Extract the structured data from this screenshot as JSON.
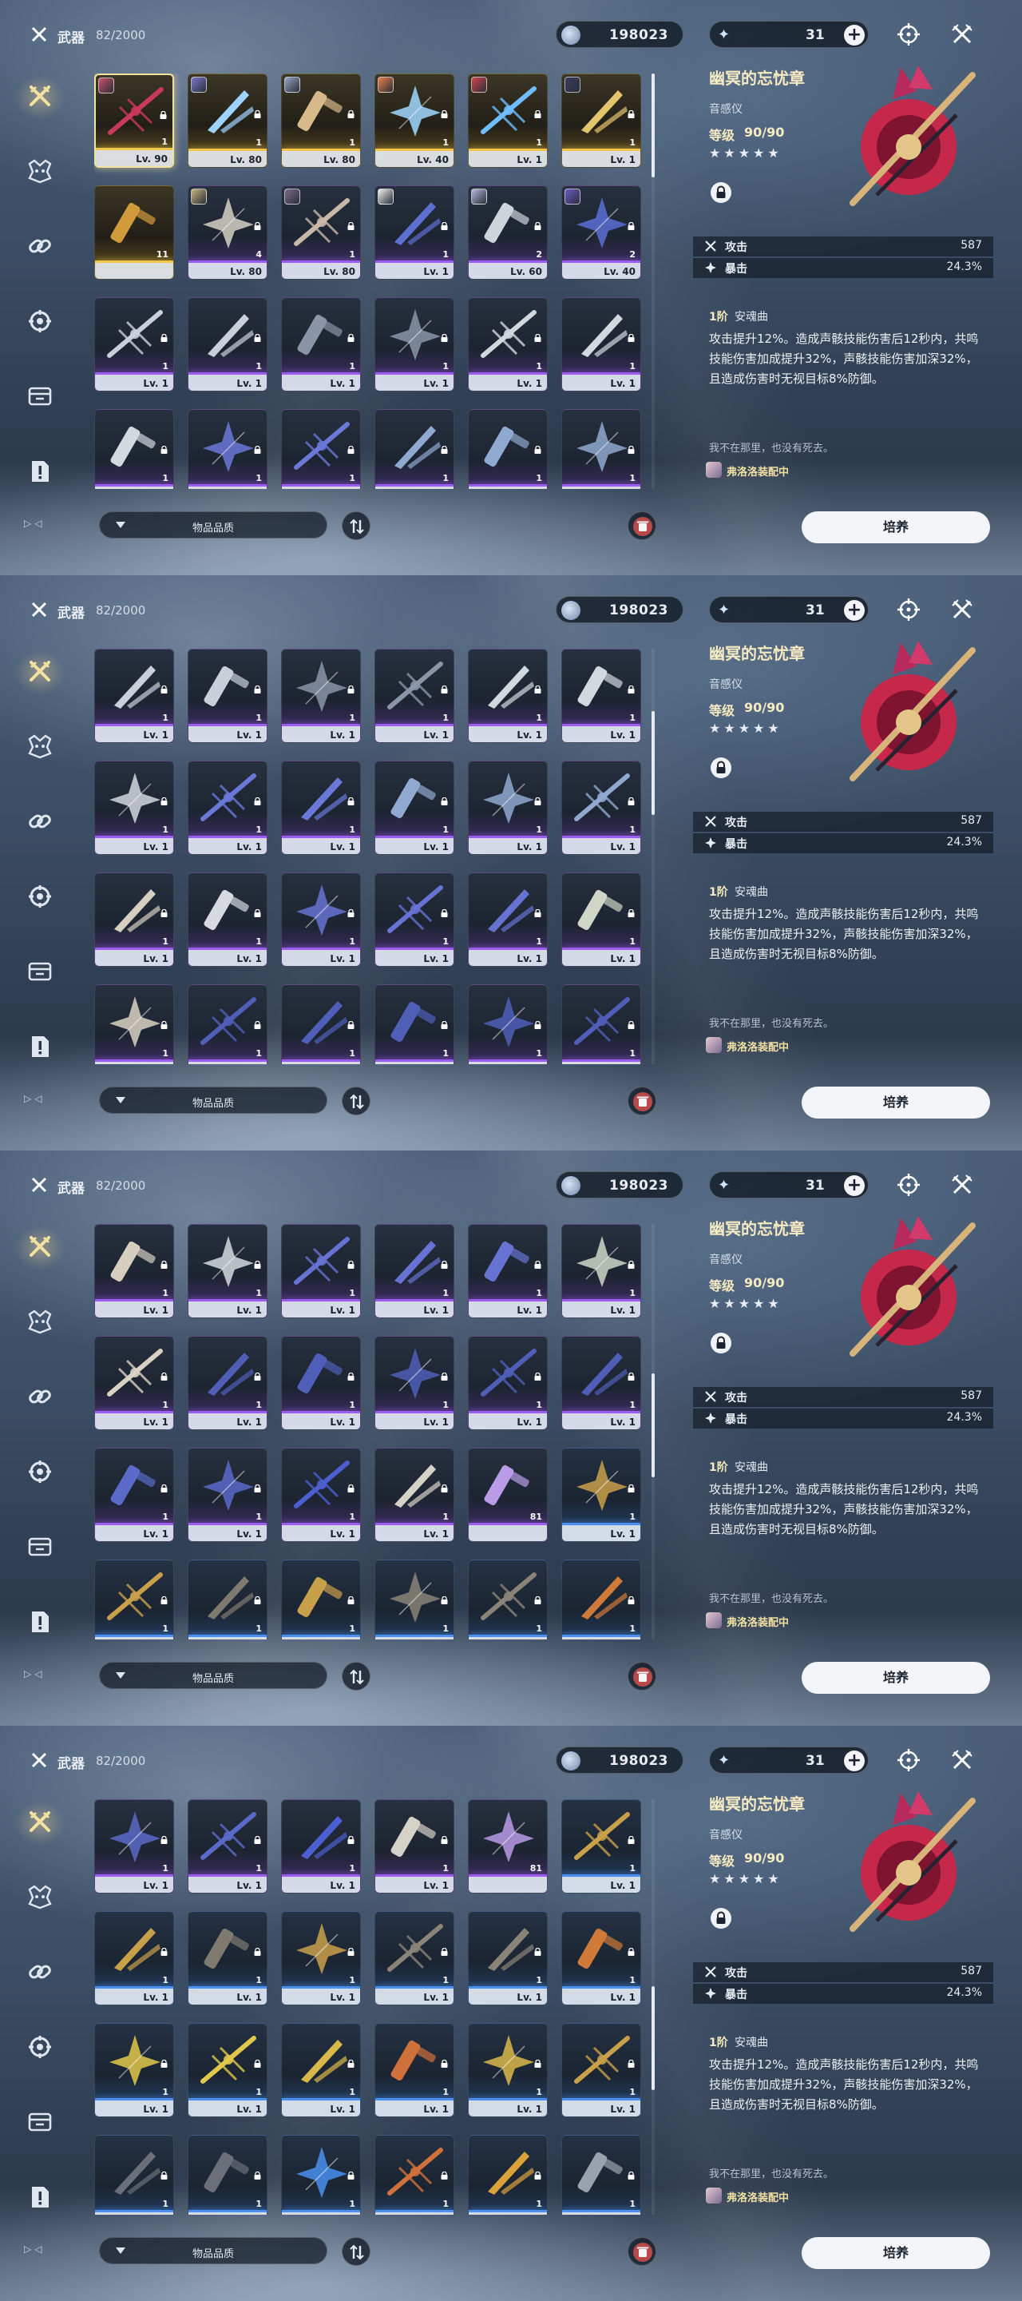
{
  "header": {
    "title": "武器",
    "count": "82/2000",
    "coins": "198023",
    "energy": "31",
    "plus": "+"
  },
  "sidebar": {
    "items": [
      {
        "name": "weapon-icon",
        "active": true
      },
      {
        "name": "echo-icon"
      },
      {
        "name": "link-icon"
      },
      {
        "name": "gear-item-icon"
      },
      {
        "name": "supply-icon"
      },
      {
        "name": "quest-item-icon"
      }
    ],
    "nav": "▷◁"
  },
  "filter": {
    "label": "物品品质"
  },
  "detail": {
    "name": "幽冥的忘忧章",
    "type": "音感仪",
    "level_label": "等级",
    "level_value": "90/90",
    "stars": "★★★★★",
    "stats": [
      {
        "name": "攻击",
        "value": "587",
        "icon": "attack-icon"
      },
      {
        "name": "暴击",
        "value": "24.3%",
        "icon": "crit-icon"
      }
    ],
    "rank": "1阶",
    "rank_name": "安魂曲",
    "description": "攻击提升12%。造成声骸技能伤害后12秒内，共鸣技能伤害加成提升32%，声骸技能伤害加深32%，且造成伤害时无视目标8%防御。",
    "quote": "我不在那里，也没有死去。",
    "equipped_by": "弗洛洛装配中",
    "button": "培养"
  },
  "colors": {
    "accent_gold": "#f3e1a1",
    "rarity_purple": "#9b5cf0",
    "rarity_gold": "#f2c64a",
    "rarity_blue": "#4a90f0"
  },
  "panels": [
    {
      "scroll_pos": 0.0,
      "rows": [
        [
          {
            "lv": "Lv. 90",
            "qty": "1",
            "rarity": "gold",
            "avatar": "#c9506a",
            "locked": true,
            "selected": true,
            "tint": "#c9395a"
          },
          {
            "lv": "Lv. 80",
            "qty": "1",
            "rarity": "gold",
            "avatar": "#7a79c9",
            "locked": true,
            "tint": "#9fd3ff"
          },
          {
            "lv": "Lv. 80",
            "qty": "1",
            "rarity": "gold",
            "avatar": "#9aa4c2",
            "locked": true,
            "tint": "#d7b98a"
          },
          {
            "lv": "Lv. 40",
            "qty": "1",
            "rarity": "gold",
            "avatar": "#e8804a",
            "locked": true,
            "tint": "#9fd9ff"
          },
          {
            "lv": "Lv. 1",
            "qty": "1",
            "rarity": "gold",
            "avatar": "#d4424a",
            "locked": true,
            "tint": "#6fbcff"
          },
          {
            "lv": "Lv. 1",
            "qty": "1",
            "rarity": "gold",
            "avatar": "#3b3b5c",
            "locked": true,
            "tint": "#e3c36b"
          }
        ],
        [
          {
            "lv": "",
            "qty": "11",
            "rarity": "gold",
            "tint": "#d19a3a"
          },
          {
            "lv": "Lv. 80",
            "qty": "4",
            "rarity": "purple",
            "avatar": "#c9b27e",
            "locked": true,
            "tint": "#d6d1c4"
          },
          {
            "lv": "Lv. 80",
            "qty": "1",
            "rarity": "purple",
            "avatar": "#7a6b8c",
            "locked": true,
            "tint": "#c9b8a8"
          },
          {
            "lv": "Lv. 1",
            "qty": "1",
            "rarity": "purple",
            "avatar": "#f0f0f0",
            "locked": true,
            "tint": "#5d6fd0"
          },
          {
            "lv": "Lv. 60",
            "qty": "2",
            "rarity": "purple",
            "avatar": "#b6b8d9",
            "locked": true,
            "tint": "#cfd3da"
          },
          {
            "lv": "Lv. 40",
            "qty": "2",
            "rarity": "purple",
            "avatar": "#6d5ac7",
            "locked": true,
            "tint": "#5b6fd3"
          }
        ],
        [
          {
            "lv": "Lv. 1",
            "qty": "1",
            "rarity": "purple",
            "locked": true,
            "tint": "#c9d0da"
          },
          {
            "lv": "Lv. 1",
            "qty": "1",
            "rarity": "purple",
            "locked": true,
            "tint": "#c9d0da"
          },
          {
            "lv": "Lv. 1",
            "qty": "1",
            "rarity": "purple",
            "locked": true,
            "tint": "#8a96a8"
          },
          {
            "lv": "Lv. 1",
            "qty": "1",
            "rarity": "purple",
            "locked": true,
            "tint": "#8a96a8"
          },
          {
            "lv": "Lv. 1",
            "qty": "1",
            "rarity": "purple",
            "locked": true,
            "tint": "#d3d7de"
          },
          {
            "lv": "Lv. 1",
            "qty": "1",
            "rarity": "purple",
            "locked": true,
            "tint": "#d3d7de"
          }
        ],
        [
          {
            "lv": "",
            "qty": "1",
            "rarity": "purple",
            "locked": true,
            "tint": "#d3d7de"
          },
          {
            "lv": "",
            "qty": "1",
            "rarity": "purple",
            "locked": true,
            "tint": "#6a78d8"
          },
          {
            "lv": "",
            "qty": "1",
            "rarity": "purple",
            "locked": true,
            "tint": "#6a78d8"
          },
          {
            "lv": "",
            "qty": "1",
            "rarity": "purple",
            "locked": true,
            "tint": "#8fa9d0"
          },
          {
            "lv": "",
            "qty": "1",
            "rarity": "purple",
            "locked": true,
            "tint": "#8fa9d0"
          },
          {
            "lv": "",
            "qty": "1",
            "rarity": "purple",
            "locked": true,
            "tint": "#8fa9d0"
          }
        ]
      ]
    },
    {
      "scroll_pos": 0.2,
      "rows": [
        [
          {
            "lv": "Lv. 1",
            "qty": "1",
            "rarity": "purple",
            "locked": true,
            "tint": "#c9d0da"
          },
          {
            "lv": "Lv. 1",
            "qty": "1",
            "rarity": "purple",
            "locked": true,
            "tint": "#c9d0da"
          },
          {
            "lv": "Lv. 1",
            "qty": "1",
            "rarity": "purple",
            "locked": true,
            "tint": "#8a96a8"
          },
          {
            "lv": "Lv. 1",
            "qty": "1",
            "rarity": "purple",
            "locked": true,
            "tint": "#8a96a8"
          },
          {
            "lv": "Lv. 1",
            "qty": "1",
            "rarity": "purple",
            "locked": true,
            "tint": "#d3d7de"
          },
          {
            "lv": "Lv. 1",
            "qty": "1",
            "rarity": "purple",
            "locked": true,
            "tint": "#d3d7de"
          }
        ],
        [
          {
            "lv": "Lv. 1",
            "qty": "1",
            "rarity": "purple",
            "locked": true,
            "tint": "#d3d7de"
          },
          {
            "lv": "Lv. 1",
            "qty": "1",
            "rarity": "purple",
            "locked": true,
            "tint": "#6a78d8"
          },
          {
            "lv": "Lv. 1",
            "qty": "1",
            "rarity": "purple",
            "locked": true,
            "tint": "#6a78d8"
          },
          {
            "lv": "Lv. 1",
            "qty": "1",
            "rarity": "purple",
            "locked": true,
            "tint": "#8fa9d0"
          },
          {
            "lv": "Lv. 1",
            "qty": "1",
            "rarity": "purple",
            "locked": true,
            "tint": "#8fa9d0"
          },
          {
            "lv": "Lv. 1",
            "qty": "1",
            "rarity": "purple",
            "locked": true,
            "tint": "#8fa9d0"
          }
        ],
        [
          {
            "lv": "Lv. 1",
            "qty": "1",
            "rarity": "purple",
            "locked": true,
            "tint": "#d6cfc0"
          },
          {
            "lv": "Lv. 1",
            "qty": "1",
            "rarity": "purple",
            "locked": true,
            "tint": "#d6d9df"
          },
          {
            "lv": "Lv. 1",
            "qty": "1",
            "rarity": "purple",
            "locked": true,
            "tint": "#6673d2"
          },
          {
            "lv": "Lv. 1",
            "qty": "1",
            "rarity": "purple",
            "locked": true,
            "tint": "#6673d2"
          },
          {
            "lv": "Lv. 1",
            "qty": "1",
            "rarity": "purple",
            "locked": true,
            "tint": "#6673d2"
          },
          {
            "lv": "Lv. 1",
            "qty": "1",
            "rarity": "purple",
            "locked": true,
            "tint": "#cfd6c8"
          }
        ],
        [
          {
            "lv": "",
            "qty": "1",
            "rarity": "purple",
            "locked": true,
            "tint": "#d9d2c2"
          },
          {
            "lv": "",
            "qty": "1",
            "rarity": "purple",
            "locked": true,
            "tint": "#4f5fb8"
          },
          {
            "lv": "",
            "qty": "1",
            "rarity": "purple",
            "locked": true,
            "tint": "#4f5fb8"
          },
          {
            "lv": "",
            "qty": "1",
            "rarity": "purple",
            "locked": true,
            "tint": "#4f5fb8"
          },
          {
            "lv": "",
            "qty": "1",
            "rarity": "purple",
            "locked": true,
            "tint": "#4f5fb8"
          },
          {
            "lv": "",
            "qty": "1",
            "rarity": "purple",
            "locked": true,
            "tint": "#4f5fb8"
          }
        ]
      ]
    },
    {
      "scroll_pos": 0.48,
      "rows": [
        [
          {
            "lv": "Lv. 1",
            "qty": "1",
            "rarity": "purple",
            "locked": true,
            "tint": "#d6cfc0"
          },
          {
            "lv": "Lv. 1",
            "qty": "1",
            "rarity": "purple",
            "locked": true,
            "tint": "#d6d9df"
          },
          {
            "lv": "Lv. 1",
            "qty": "1",
            "rarity": "purple",
            "locked": true,
            "tint": "#6673d2"
          },
          {
            "lv": "Lv. 1",
            "qty": "1",
            "rarity": "purple",
            "locked": true,
            "tint": "#6673d2"
          },
          {
            "lv": "Lv. 1",
            "qty": "1",
            "rarity": "purple",
            "locked": true,
            "tint": "#6673d2"
          },
          {
            "lv": "Lv. 1",
            "qty": "1",
            "rarity": "purple",
            "locked": true,
            "tint": "#cfd6c8"
          }
        ],
        [
          {
            "lv": "Lv. 1",
            "qty": "1",
            "rarity": "purple",
            "locked": true,
            "tint": "#d9d2c2"
          },
          {
            "lv": "Lv. 1",
            "qty": "1",
            "rarity": "purple",
            "locked": true,
            "tint": "#4f5fb8"
          },
          {
            "lv": "Lv. 1",
            "qty": "1",
            "rarity": "purple",
            "locked": true,
            "tint": "#4f5fb8"
          },
          {
            "lv": "Lv. 1",
            "qty": "1",
            "rarity": "purple",
            "locked": true,
            "tint": "#4f5fb8"
          },
          {
            "lv": "Lv. 1",
            "qty": "1",
            "rarity": "purple",
            "locked": true,
            "tint": "#4f5fb8"
          },
          {
            "lv": "Lv. 1",
            "qty": "1",
            "rarity": "purple",
            "locked": true,
            "tint": "#4f5fb8"
          }
        ],
        [
          {
            "lv": "Lv. 1",
            "qty": "1",
            "rarity": "purple",
            "locked": true,
            "tint": "#5a6ac8"
          },
          {
            "lv": "Lv. 1",
            "qty": "1",
            "rarity": "purple",
            "locked": true,
            "tint": "#5a6ac8"
          },
          {
            "lv": "Lv. 1",
            "qty": "1",
            "rarity": "purple",
            "locked": true,
            "tint": "#4b5fd0"
          },
          {
            "lv": "Lv. 1",
            "qty": "1",
            "rarity": "purple",
            "locked": true,
            "tint": "#d7d2c8"
          },
          {
            "lv": "",
            "qty": "81",
            "rarity": "purple",
            "tint": "#b99be8"
          },
          {
            "lv": "Lv. 1",
            "qty": "1",
            "rarity": "blue",
            "locked": true,
            "tint": "#c9a04a"
          }
        ],
        [
          {
            "lv": "",
            "qty": "1",
            "rarity": "blue",
            "locked": true,
            "tint": "#c9a04a"
          },
          {
            "lv": "",
            "qty": "1",
            "rarity": "blue",
            "locked": true,
            "tint": "#7f7a70"
          },
          {
            "lv": "",
            "qty": "1",
            "rarity": "blue",
            "locked": true,
            "tint": "#c9a04a"
          },
          {
            "lv": "",
            "qty": "1",
            "rarity": "blue",
            "locked": true,
            "tint": "#8a8478"
          },
          {
            "lv": "",
            "qty": "1",
            "rarity": "blue",
            "locked": true,
            "tint": "#8a8478"
          },
          {
            "lv": "",
            "qty": "1",
            "rarity": "blue",
            "locked": true,
            "tint": "#d07a3a"
          }
        ]
      ]
    },
    {
      "scroll_pos": 0.6,
      "rows": [
        [
          {
            "lv": "Lv. 1",
            "qty": "1",
            "rarity": "purple",
            "locked": true,
            "tint": "#5a6ac8"
          },
          {
            "lv": "Lv. 1",
            "qty": "1",
            "rarity": "purple",
            "locked": true,
            "tint": "#5a6ac8"
          },
          {
            "lv": "Lv. 1",
            "qty": "1",
            "rarity": "purple",
            "locked": true,
            "tint": "#4b5fd0"
          },
          {
            "lv": "Lv. 1",
            "qty": "1",
            "rarity": "purple",
            "locked": true,
            "tint": "#d7d2c8"
          },
          {
            "lv": "",
            "qty": "81",
            "rarity": "purple",
            "tint": "#b99be8"
          },
          {
            "lv": "Lv. 1",
            "qty": "1",
            "rarity": "blue",
            "locked": true,
            "tint": "#c9a04a"
          }
        ],
        [
          {
            "lv": "Lv. 1",
            "qty": "1",
            "rarity": "blue",
            "locked": true,
            "tint": "#c9a04a"
          },
          {
            "lv": "Lv. 1",
            "qty": "1",
            "rarity": "blue",
            "locked": true,
            "tint": "#7f7a70"
          },
          {
            "lv": "Lv. 1",
            "qty": "1",
            "rarity": "blue",
            "locked": true,
            "tint": "#c9a04a"
          },
          {
            "lv": "Lv. 1",
            "qty": "1",
            "rarity": "blue",
            "locked": true,
            "tint": "#8a8478"
          },
          {
            "lv": "Lv. 1",
            "qty": "1",
            "rarity": "blue",
            "locked": true,
            "tint": "#8a8478"
          },
          {
            "lv": "Lv. 1",
            "qty": "1",
            "rarity": "blue",
            "locked": true,
            "tint": "#d07a3a"
          }
        ],
        [
          {
            "lv": "Lv. 1",
            "qty": "1",
            "rarity": "blue",
            "locked": true,
            "tint": "#e2c84a"
          },
          {
            "lv": "Lv. 1",
            "qty": "1",
            "rarity": "blue",
            "locked": true,
            "tint": "#e2c84a"
          },
          {
            "lv": "Lv. 1",
            "qty": "1",
            "rarity": "blue",
            "locked": true,
            "tint": "#d9b84a"
          },
          {
            "lv": "Lv. 1",
            "qty": "1",
            "rarity": "blue",
            "locked": true,
            "tint": "#d0703a"
          },
          {
            "lv": "Lv. 1",
            "qty": "1",
            "rarity": "blue",
            "locked": true,
            "tint": "#d9b84a"
          },
          {
            "lv": "Lv. 1",
            "qty": "1",
            "rarity": "blue",
            "locked": true,
            "tint": "#c9a04a"
          }
        ],
        [
          {
            "lv": "",
            "qty": "1",
            "rarity": "blue",
            "locked": true,
            "tint": "#6a6f7a"
          },
          {
            "lv": "",
            "qty": "1",
            "rarity": "blue",
            "locked": true,
            "tint": "#6a6f7a"
          },
          {
            "lv": "",
            "qty": "1",
            "rarity": "blue",
            "locked": true,
            "tint": "#4a90f0"
          },
          {
            "lv": "",
            "qty": "1",
            "rarity": "blue",
            "locked": true,
            "tint": "#d0703a"
          },
          {
            "lv": "",
            "qty": "1",
            "rarity": "blue",
            "locked": true,
            "tint": "#d9a33a"
          },
          {
            "lv": "",
            "qty": "1",
            "rarity": "blue",
            "locked": true,
            "tint": "#9aa2ad"
          }
        ]
      ]
    }
  ]
}
